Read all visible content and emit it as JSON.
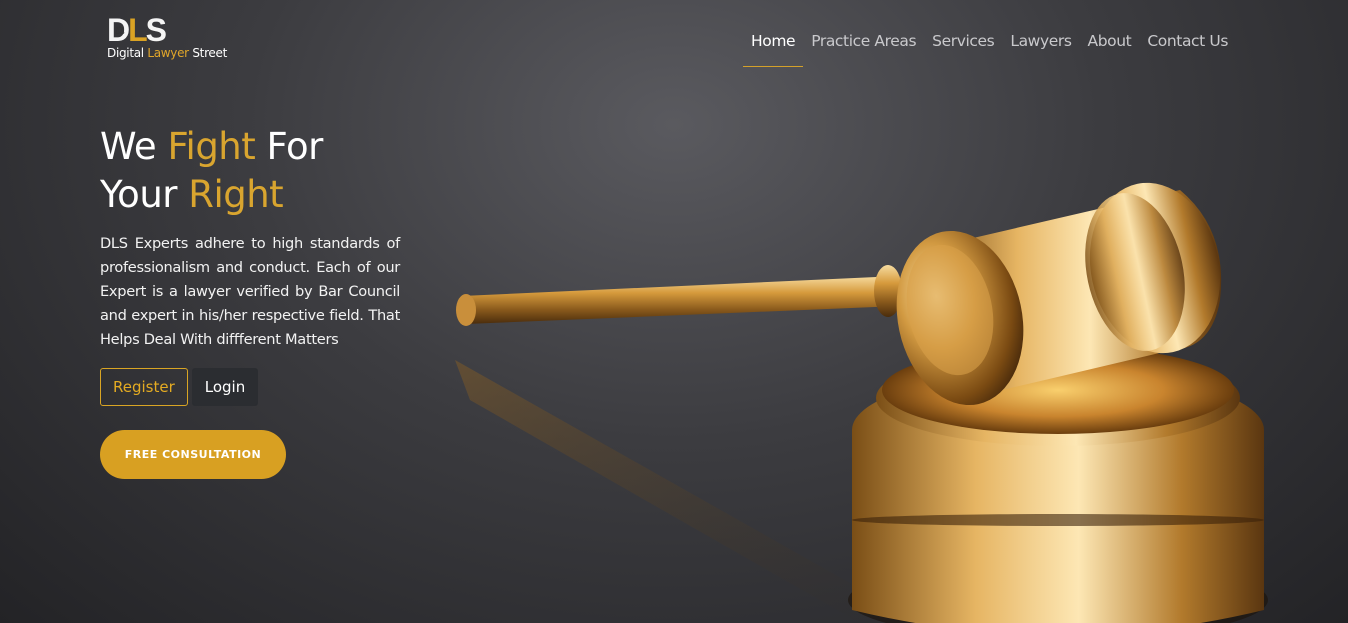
{
  "brand": {
    "logo_letters_d": "D",
    "logo_letters_l": "L",
    "logo_letters_s": "S",
    "name_part1": "Digital ",
    "name_accent": "Lawyer",
    "name_part2": " Street"
  },
  "nav": {
    "items": [
      {
        "label": "Home",
        "active": true
      },
      {
        "label": "Practice Areas"
      },
      {
        "label": "Services"
      },
      {
        "label": "Lawyers"
      },
      {
        "label": "About"
      },
      {
        "label": "Contact Us"
      }
    ]
  },
  "hero": {
    "title_we": "We ",
    "title_fight": "Fight",
    "title_for": " For",
    "title_your": "Your ",
    "title_right": "Right",
    "description": "DLS Experts adhere to high standards of professionalism and conduct. Each of our Expert is a lawyer verified by Bar Council and expert in his/her respective field. That Helps Deal With diffferent Matters",
    "register_label": "Register",
    "login_label": "Login",
    "consult_label": "FREE CONSULTATION"
  },
  "colors": {
    "accent": "#d9a524",
    "background": "#3c3c40",
    "login_button": "#2b2d31"
  },
  "icons": {
    "logo_scale": "scales-of-justice-icon",
    "hero_image": "gavel-image"
  }
}
